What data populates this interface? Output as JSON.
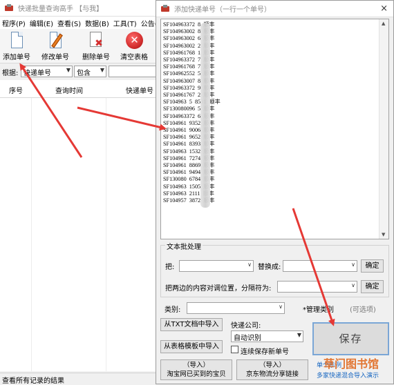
{
  "main_window": {
    "title": "快递批量查询高手 【与我】",
    "menu": [
      "程序(P)",
      "编辑(E)",
      "查看(S)",
      "数据(B)",
      "工具(T)",
      "公告(X)"
    ],
    "toolbar": {
      "add": "添加单号",
      "edit": "修改单号",
      "delete": "删除单号",
      "clear": "清空表格"
    },
    "filter": {
      "label": "根据:",
      "field": "快递单号",
      "op": "包含",
      "value": ""
    },
    "columns": [
      "序号",
      "查询时间",
      "快递单号"
    ],
    "status": "查看所有记录的结果"
  },
  "dialog": {
    "title": "添加快递单号（一行一个单号）",
    "close": "×",
    "tracking_lines": [
      "SF104963372  8  顺丰",
      "SF104963002  8  顺丰",
      "SF104963002  6  顺丰",
      "SF104963002  2  顺丰",
      "SF104961768  1  顺丰",
      "SF104963372  7  顺丰",
      "SF104961768  7  顺丰",
      "SF104962552  5  顺丰",
      "SF104963007  8  顺丰",
      "SF104963372  9  顺丰",
      "SF104961767  2  顺丰",
      "SF104963  5  8531  顺丰",
      "SF130080096  5  顺丰",
      "SF104963372  6  顺丰",
      "SF104961  9352  顺丰",
      "SF104961  9006  顺丰",
      "SF104961  9652  顺丰",
      "SF104961  8393  顺丰",
      "SF104963  1532  顺丰",
      "SF104961  7274  顺丰",
      "SF104961  8869  顺丰",
      "SF104961  9494  顺丰",
      "SF130080  6784  顺丰",
      "SF104963  1505  顺丰",
      "SF104963  2111  顺丰",
      "SF104957  3872  顺丰"
    ],
    "batch": {
      "group_title": "文本批处理",
      "replace_label": "把:",
      "replace_with": "替换成:",
      "confirm1": "确定",
      "swap_label": "把两边的内容对调位置，分隔符为:",
      "confirm2": "确定"
    },
    "category_label": "类别:",
    "manage_category": "*管理类别",
    "optional": "(可选项)",
    "import_txt": "从TXT文档中导入",
    "import_template": "从表格模板中导入",
    "courier_label": "快递公司:",
    "courier_value": "自动识别",
    "keep_saving": "连续保存新单号",
    "save": "保存",
    "import_taobao_top": "（导入）",
    "import_taobao": "淘宝网已买到的宝贝",
    "import_jd_top": "（导入）",
    "import_jd": "京东物流分享链接",
    "link_single": "单个示例",
    "link_multi": "多家快递混合导入演示"
  },
  "watermark": "草门图书馆",
  "colors": {
    "arrow": "#e53935",
    "save_border": "#7aa6d6",
    "link": "#1565c0"
  }
}
